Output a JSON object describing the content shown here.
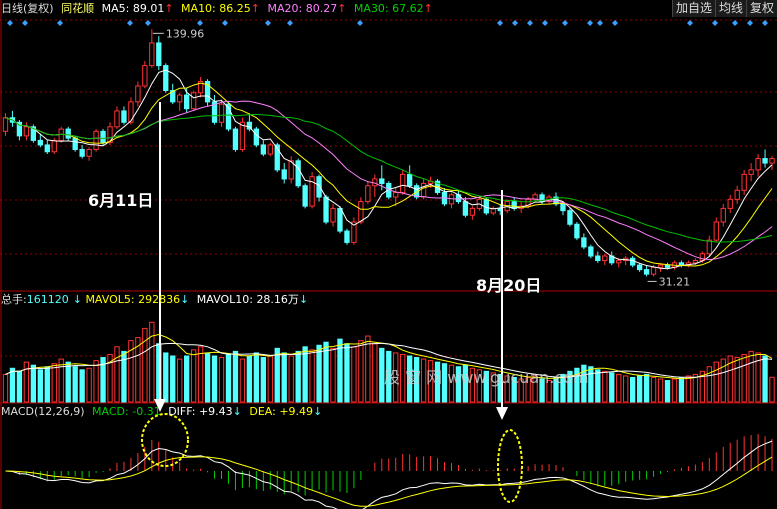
{
  "header": {
    "period": "日线(复权)",
    "name": "同花顺",
    "ma5_label": "MA5:",
    "ma5": "89.01",
    "ma10_label": "MA10:",
    "ma10": "86.25",
    "ma20_label": "MA20:",
    "ma20": "80.27",
    "ma30_label": "MA30:",
    "ma30": "67.62",
    "arrow_up": "↑",
    "buttons": [
      "加自选",
      "均线",
      "复权"
    ]
  },
  "volume_header": {
    "total_label": "总手:",
    "total": "161120",
    "mavol5_label": "MAVOL5:",
    "mavol5": "292836",
    "mavol10_label": "MAVOL10:",
    "mavol10": "28.16万",
    "arrow_down": "↓"
  },
  "macd_header": {
    "title": "MACD(12,26,9)",
    "macd_label": "MACD:",
    "macd": "-0.31",
    "diff_label": "DIFF:",
    "diff": "+9.43",
    "dea_label": "DEA:",
    "dea": "+9.49",
    "arrow_down": "↓"
  },
  "annotations": {
    "high": "139.96",
    "low": "31.21",
    "date1": "6月11日",
    "date2": "8月20日",
    "watermark": "股 窗 网  www.gucuan.com"
  },
  "colors": {
    "background": "#000000",
    "up": "#ff3232",
    "down": "#54ffff",
    "ma5": "#ffffff",
    "ma10": "#ffff00",
    "ma20": "#ff80ff",
    "ma30": "#00c000",
    "grid": "#8b0000",
    "diamond": "#3aa0ff"
  },
  "chart_data": {
    "type": "candlestick",
    "price_range": [
      25,
      145
    ],
    "candles": [
      [
        95,
        103,
        93,
        101
      ],
      [
        101,
        104,
        97,
        99
      ],
      [
        99,
        100,
        91,
        93
      ],
      [
        93,
        99,
        91,
        97
      ],
      [
        97,
        98,
        90,
        91
      ],
      [
        91,
        94,
        88,
        89
      ],
      [
        89,
        91,
        85,
        86
      ],
      [
        86,
        92,
        85,
        91
      ],
      [
        91,
        97,
        90,
        96
      ],
      [
        96,
        97,
        91,
        92
      ],
      [
        92,
        93,
        86,
        87
      ],
      [
        87,
        89,
        83,
        84
      ],
      [
        84,
        88,
        82,
        87
      ],
      [
        87,
        96,
        86,
        95
      ],
      [
        95,
        96,
        89,
        90
      ],
      [
        90,
        99,
        89,
        97
      ],
      [
        97,
        106,
        96,
        104
      ],
      [
        104,
        106,
        98,
        99
      ],
      [
        99,
        110,
        98,
        108
      ],
      [
        108,
        117,
        106,
        115
      ],
      [
        115,
        126,
        114,
        124
      ],
      [
        124,
        140,
        123,
        134
      ],
      [
        134,
        137,
        122,
        124
      ],
      [
        124,
        125,
        112,
        113
      ],
      [
        113,
        116,
        107,
        108
      ],
      [
        108,
        112,
        104,
        111
      ],
      [
        111,
        114,
        103,
        105
      ],
      [
        105,
        113,
        104,
        112
      ],
      [
        112,
        119,
        110,
        117
      ],
      [
        117,
        118,
        106,
        108
      ],
      [
        108,
        111,
        98,
        99
      ],
      [
        99,
        109,
        97,
        107
      ],
      [
        107,
        108,
        95,
        96
      ],
      [
        96,
        97,
        86,
        87
      ],
      [
        87,
        101,
        86,
        99
      ],
      [
        99,
        103,
        95,
        96
      ],
      [
        96,
        97,
        88,
        89
      ],
      [
        89,
        91,
        84,
        85
      ],
      [
        85,
        90,
        84,
        89
      ],
      [
        89,
        90,
        77,
        78
      ],
      [
        78,
        81,
        72,
        74
      ],
      [
        74,
        84,
        72,
        82
      ],
      [
        82,
        83,
        70,
        71
      ],
      [
        71,
        72,
        61,
        62
      ],
      [
        62,
        77,
        61,
        75
      ],
      [
        75,
        76,
        64,
        66
      ],
      [
        66,
        67,
        54,
        55
      ],
      [
        55,
        63,
        53,
        61
      ],
      [
        61,
        62,
        50,
        51
      ],
      [
        51,
        52,
        45,
        46
      ],
      [
        46,
        57,
        45,
        55
      ],
      [
        55,
        66,
        54,
        64
      ],
      [
        64,
        73,
        63,
        71
      ],
      [
        71,
        76,
        66,
        74
      ],
      [
        74,
        80,
        69,
        72
      ],
      [
        72,
        73,
        65,
        66
      ],
      [
        66,
        70,
        62,
        68
      ],
      [
        68,
        78,
        67,
        76
      ],
      [
        76,
        80,
        70,
        71
      ],
      [
        71,
        72,
        65,
        66
      ],
      [
        66,
        74,
        65,
        72
      ],
      [
        72,
        75,
        70,
        73
      ],
      [
        73,
        74,
        67,
        68
      ],
      [
        68,
        70,
        62,
        63
      ],
      [
        63,
        68,
        61,
        67
      ],
      [
        67,
        69,
        63,
        64
      ],
      [
        64,
        66,
        57,
        58
      ],
      [
        58,
        62,
        56,
        61
      ],
      [
        61,
        66,
        60,
        65
      ],
      [
        65,
        66,
        58,
        59
      ],
      [
        59,
        62,
        58,
        61
      ],
      [
        61,
        63,
        58,
        60
      ],
      [
        60,
        65,
        59,
        64
      ],
      [
        64,
        66,
        60,
        61
      ],
      [
        61,
        64,
        59,
        62
      ],
      [
        62,
        66,
        61,
        65
      ],
      [
        65,
        68,
        64,
        67
      ],
      [
        67,
        68,
        63,
        64
      ],
      [
        64,
        67,
        63,
        66
      ],
      [
        66,
        68,
        62,
        63
      ],
      [
        63,
        64,
        58,
        60
      ],
      [
        60,
        61,
        53,
        54
      ],
      [
        54,
        55,
        47,
        48
      ],
      [
        48,
        50,
        43,
        44
      ],
      [
        44,
        45,
        39,
        40
      ],
      [
        40,
        42,
        37,
        38
      ],
      [
        38,
        41,
        36,
        40
      ],
      [
        40,
        42,
        36,
        37
      ],
      [
        37,
        39,
        35,
        38
      ],
      [
        38,
        40,
        36,
        39
      ],
      [
        39,
        40,
        35,
        36
      ],
      [
        36,
        37,
        33,
        34
      ],
      [
        34,
        36,
        31,
        32
      ],
      [
        32,
        36,
        31,
        35
      ],
      [
        35,
        37,
        33,
        36
      ],
      [
        36,
        37,
        34,
        35
      ],
      [
        35,
        38,
        34,
        37
      ],
      [
        37,
        38,
        35,
        36
      ],
      [
        36,
        38,
        35,
        37
      ],
      [
        37,
        39,
        36,
        38
      ],
      [
        38,
        42,
        37,
        41
      ],
      [
        41,
        49,
        40,
        47
      ],
      [
        47,
        57,
        46,
        55
      ],
      [
        55,
        63,
        53,
        61
      ],
      [
        61,
        67,
        59,
        65
      ],
      [
        65,
        71,
        63,
        69
      ],
      [
        69,
        78,
        67,
        76
      ],
      [
        76,
        81,
        73,
        78
      ],
      [
        78,
        85,
        75,
        83
      ],
      [
        83,
        87,
        79,
        81
      ],
      [
        81,
        84,
        78,
        83
      ]
    ],
    "volume_range": [
      0,
      600000
    ],
    "volumes": [
      180000,
      220000,
      200000,
      260000,
      240000,
      210000,
      230000,
      250000,
      280000,
      260000,
      230000,
      210000,
      220000,
      270000,
      290000,
      310000,
      360000,
      330000,
      400000,
      420000,
      480000,
      520000,
      380000,
      320000,
      300000,
      280000,
      300000,
      340000,
      360000,
      320000,
      300000,
      290000,
      310000,
      330000,
      280000,
      300000,
      320000,
      290000,
      300000,
      350000,
      320000,
      300000,
      330000,
      360000,
      340000,
      370000,
      390000,
      350000,
      410000,
      380000,
      360000,
      400000,
      430000,
      380000,
      350000,
      330000,
      320000,
      310000,
      300000,
      290000,
      280000,
      270000,
      260000,
      250000,
      240000,
      230000,
      240000,
      220000,
      210000,
      200000,
      190000,
      180000,
      170000,
      160000,
      150000,
      160000,
      170000,
      150000,
      140000,
      160000,
      180000,
      200000,
      220000,
      240000,
      230000,
      210000,
      200000,
      190000,
      180000,
      170000,
      160000,
      170000,
      180000,
      160000,
      150000,
      140000,
      150000,
      160000,
      170000,
      180000,
      200000,
      230000,
      260000,
      280000,
      300000,
      290000,
      310000,
      330000,
      320000,
      300000,
      161120
    ],
    "macd_range": [
      -6,
      6
    ],
    "macd_note": "DIFF/DEA/MACD derived from closing prices"
  }
}
